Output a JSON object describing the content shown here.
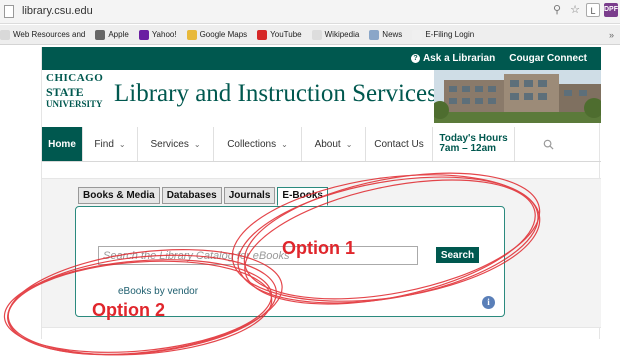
{
  "browser": {
    "url": "library.csu.edu",
    "profile_letter": "L",
    "ext_label": "DPF",
    "bookmarks": [
      {
        "label": "Web Resources and",
        "color": "#d9d9d9"
      },
      {
        "label": "Apple",
        "color": "#666666"
      },
      {
        "label": "Yahoo!",
        "color": "#6a1fa2"
      },
      {
        "label": "Google Maps",
        "color": "#e8b93a"
      },
      {
        "label": "YouTube",
        "color": "#d62828"
      },
      {
        "label": "Wikipedia",
        "color": "#dddddd"
      },
      {
        "label": "News",
        "color": "#8aa6c8"
      },
      {
        "label": "E-Filing Login",
        "color": "#f0f0f0"
      }
    ],
    "more": "»"
  },
  "header": {
    "ask_librarian": "Ask a Librarian",
    "cougar_connect": "Cougar Connect",
    "logo": {
      "line1": "CHICAGO",
      "line2": "STATE",
      "line3": "UNIVERSITY"
    },
    "title": "Library and Instruction Services"
  },
  "nav": {
    "home": "Home",
    "find": "Find",
    "services": "Services",
    "collections": "Collections",
    "about": "About",
    "contact": "Contact Us",
    "hours_label": "Today's Hours",
    "hours_value": "7am – 12am"
  },
  "search": {
    "tabs": [
      "Books & Media",
      "Databases",
      "Journals",
      "E-Books"
    ],
    "active_tab": "E-Books",
    "placeholder": "Search the Library Catalog for eBooks",
    "button": "Search",
    "vendor_link": "eBooks by vendor",
    "info": "i"
  },
  "annotations": {
    "option1": "Option 1",
    "option2": "Option 2",
    "color": "#e0262c"
  },
  "colors": {
    "brand": "#00584f",
    "tab_border": "#2a8a7e"
  }
}
